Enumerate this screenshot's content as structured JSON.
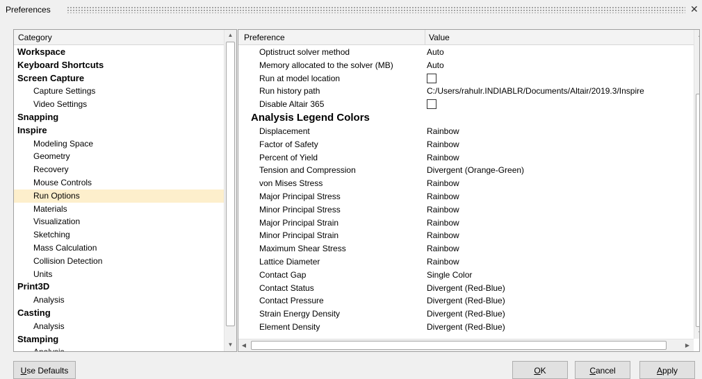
{
  "window": {
    "title": "Preferences",
    "close_glyph": "✕"
  },
  "category_panel": {
    "header": "Category",
    "items": [
      {
        "label": "Workspace",
        "level": 0
      },
      {
        "label": "Keyboard Shortcuts",
        "level": 0
      },
      {
        "label": "Screen Capture",
        "level": 0
      },
      {
        "label": "Capture Settings",
        "level": 1
      },
      {
        "label": "Video Settings",
        "level": 1
      },
      {
        "label": "Snapping",
        "level": 0
      },
      {
        "label": "Inspire",
        "level": 0
      },
      {
        "label": "Modeling Space",
        "level": 1
      },
      {
        "label": "Geometry",
        "level": 1
      },
      {
        "label": "Recovery",
        "level": 1
      },
      {
        "label": "Mouse Controls",
        "level": 1
      },
      {
        "label": "Run Options",
        "level": 1,
        "selected": true
      },
      {
        "label": "Materials",
        "level": 1
      },
      {
        "label": "Visualization",
        "level": 1
      },
      {
        "label": "Sketching",
        "level": 1
      },
      {
        "label": "Mass Calculation",
        "level": 1
      },
      {
        "label": "Collision Detection",
        "level": 1
      },
      {
        "label": "Units",
        "level": 1
      },
      {
        "label": "Print3D",
        "level": 0
      },
      {
        "label": "Analysis",
        "level": 1
      },
      {
        "label": "Casting",
        "level": 0
      },
      {
        "label": "Analysis",
        "level": 1
      },
      {
        "label": "Stamping",
        "level": 0
      },
      {
        "label": "Analysis",
        "level": 1
      }
    ]
  },
  "preference_panel": {
    "header_preference": "Preference",
    "header_value": "Value",
    "rows": [
      {
        "key": "Optistruct solver method",
        "value": "Auto"
      },
      {
        "key": "Memory allocated to the solver (MB)",
        "value": "Auto"
      },
      {
        "key": "Run at model location",
        "checkbox": true,
        "checked": false
      },
      {
        "key": "Run history path",
        "value": "C:/Users/rahulr.INDIABLR/Documents/Altair/2019.3/Inspire"
      },
      {
        "key": "Disable Altair 365",
        "checkbox": true,
        "checked": false
      },
      {
        "section": "Analysis Legend Colors"
      },
      {
        "key": "Displacement",
        "value": "Rainbow"
      },
      {
        "key": "Factor of Safety",
        "value": "Rainbow"
      },
      {
        "key": "Percent of Yield",
        "value": "Rainbow"
      },
      {
        "key": "Tension and Compression",
        "value": "Divergent (Orange-Green)"
      },
      {
        "key": "von Mises Stress",
        "value": "Rainbow"
      },
      {
        "key": "Major Principal Stress",
        "value": "Rainbow"
      },
      {
        "key": "Minor Principal Stress",
        "value": "Rainbow"
      },
      {
        "key": "Major Principal Strain",
        "value": "Rainbow"
      },
      {
        "key": "Minor Principal Strain",
        "value": "Rainbow"
      },
      {
        "key": "Maximum Shear Stress",
        "value": "Rainbow"
      },
      {
        "key": "Lattice Diameter",
        "value": "Rainbow"
      },
      {
        "key": "Contact Gap",
        "value": "Single Color"
      },
      {
        "key": "Contact Status",
        "value": "Divergent (Red-Blue)"
      },
      {
        "key": "Contact Pressure",
        "value": "Divergent (Red-Blue)"
      },
      {
        "key": "Strain Energy Density",
        "value": "Divergent (Red-Blue)"
      },
      {
        "key": "Element Density",
        "value": "Divergent (Red-Blue)"
      }
    ]
  },
  "buttons": {
    "use_defaults": {
      "mnemonic": "U",
      "rest": "se Defaults"
    },
    "ok": {
      "mnemonic": "O",
      "rest": "K"
    },
    "cancel": {
      "mnemonic": "C",
      "rest": "ancel"
    },
    "apply": {
      "mnemonic": "A",
      "rest": "pply"
    }
  },
  "colors": {
    "selected_row": "#fdefcc",
    "window_bg": "#f0f0f0",
    "panel_border": "#a0a0a0"
  }
}
